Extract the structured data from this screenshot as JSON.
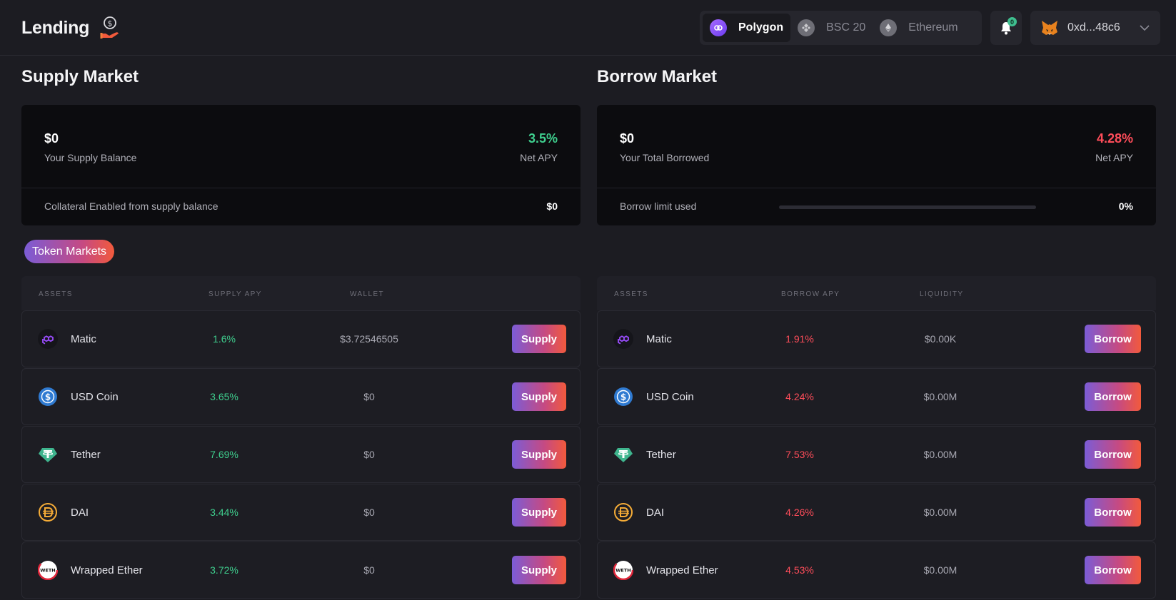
{
  "header": {
    "title": "Lending",
    "networks": [
      {
        "label": "Polygon",
        "active": true
      },
      {
        "label": "BSC 20",
        "active": false
      },
      {
        "label": "Ethereum",
        "active": false
      }
    ],
    "notifications_count": "0",
    "wallet_address": "0xd...48c6"
  },
  "supply": {
    "title": "Supply Market",
    "balance": "$0",
    "balance_label": "Your Supply Balance",
    "net_apy": "3.5%",
    "net_apy_label": "Net APY",
    "collateral_label": "Collateral Enabled from supply balance",
    "collateral_value": "$0",
    "columns": [
      "ASSETS",
      "SUPPLY APY",
      "WALLET"
    ],
    "action_label": "Supply",
    "rows": [
      {
        "name": "Matic",
        "icon": "matic-icon",
        "apy": "1.6%",
        "wallet": "$3.72546505"
      },
      {
        "name": "USD Coin",
        "icon": "usdc-icon",
        "apy": "3.65%",
        "wallet": "$0"
      },
      {
        "name": "Tether",
        "icon": "tether-icon",
        "apy": "7.69%",
        "wallet": "$0"
      },
      {
        "name": "DAI",
        "icon": "dai-icon",
        "apy": "3.44%",
        "wallet": "$0"
      },
      {
        "name": "Wrapped Ether",
        "icon": "weth-icon",
        "apy": "3.72%",
        "wallet": "$0"
      }
    ]
  },
  "borrow": {
    "title": "Borrow Market",
    "total": "$0",
    "total_label": "Your Total Borrowed",
    "net_apy": "4.28%",
    "net_apy_label": "Net APY",
    "limit_label": "Borrow limit used",
    "limit_value": "0%",
    "limit_fraction": 0,
    "columns": [
      "ASSETS",
      "BORROW APY",
      "LIQUIDITY"
    ],
    "action_label": "Borrow",
    "rows": [
      {
        "name": "Matic",
        "icon": "matic-icon",
        "apy": "1.91%",
        "liquidity": "$0.00K"
      },
      {
        "name": "USD Coin",
        "icon": "usdc-icon",
        "apy": "4.24%",
        "liquidity": "$0.00M"
      },
      {
        "name": "Tether",
        "icon": "tether-icon",
        "apy": "7.53%",
        "liquidity": "$0.00M"
      },
      {
        "name": "DAI",
        "icon": "dai-icon",
        "apy": "4.26%",
        "liquidity": "$0.00M"
      },
      {
        "name": "Wrapped Ether",
        "icon": "weth-icon",
        "apy": "4.53%",
        "liquidity": "$0.00M"
      }
    ]
  },
  "tabs": {
    "token_markets": "Token Markets"
  },
  "colors": {
    "positive": "#3fcf8e",
    "negative": "#ff4d5a",
    "accent_start": "#7b5cd6",
    "accent_end": "#f25a3c"
  },
  "icons": {
    "weth_text": "WETH"
  }
}
